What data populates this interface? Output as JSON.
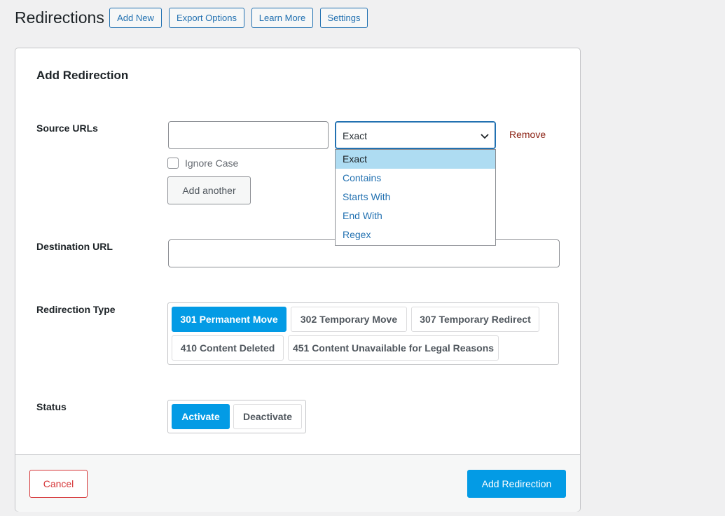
{
  "header": {
    "title": "Redirections",
    "buttons": [
      "Add New",
      "Export Options",
      "Learn More",
      "Settings"
    ]
  },
  "card": {
    "title": "Add Redirection",
    "source": {
      "label": "Source URLs",
      "url_value": "",
      "match_selected": "Exact",
      "match_options": [
        "Exact",
        "Contains",
        "Starts With",
        "End With",
        "Regex"
      ],
      "remove_label": "Remove",
      "ignore_case_label": "Ignore Case",
      "ignore_case_checked": false,
      "add_another_label": "Add another"
    },
    "destination": {
      "label": "Destination URL",
      "value": ""
    },
    "redirection_type": {
      "label": "Redirection Type",
      "options": [
        "301 Permanent Move",
        "302 Temporary Move",
        "307 Temporary Redirect",
        "410 Content Deleted",
        "451 Content Unavailable for Legal Reasons"
      ],
      "selected": "301 Permanent Move"
    },
    "status": {
      "label": "Status",
      "options": [
        "Activate",
        "Deactivate"
      ],
      "selected": "Activate"
    },
    "footer": {
      "cancel_label": "Cancel",
      "submit_label": "Add Redirection"
    }
  },
  "colors": {
    "accent": "#039be5",
    "link": "#2271b1",
    "danger": "#d63638",
    "remove": "#8a1f11",
    "dropdown_highlight": "#aedcf2"
  }
}
